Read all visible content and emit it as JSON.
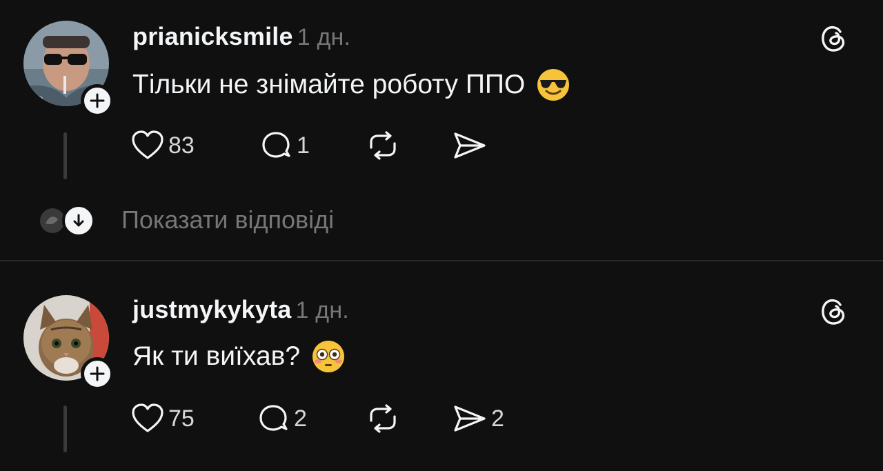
{
  "posts": [
    {
      "username": "prianicksmile",
      "time": "1 дн.",
      "text": "Тільки не знімайте роботу ППО",
      "emoji": "smiling-face-with-sunglasses",
      "likes": "83",
      "replies": "1",
      "shares": ""
    },
    {
      "username": "justmykykyta",
      "time": "1 дн.",
      "text": "Як ти виїхав?",
      "emoji": "flushed-face",
      "likes": "75",
      "replies": "2",
      "shares": "2"
    }
  ],
  "show_replies": "Показати відповіді",
  "colors": {
    "background": "#101010",
    "text": "#f3f5f7",
    "muted": "#777777"
  }
}
